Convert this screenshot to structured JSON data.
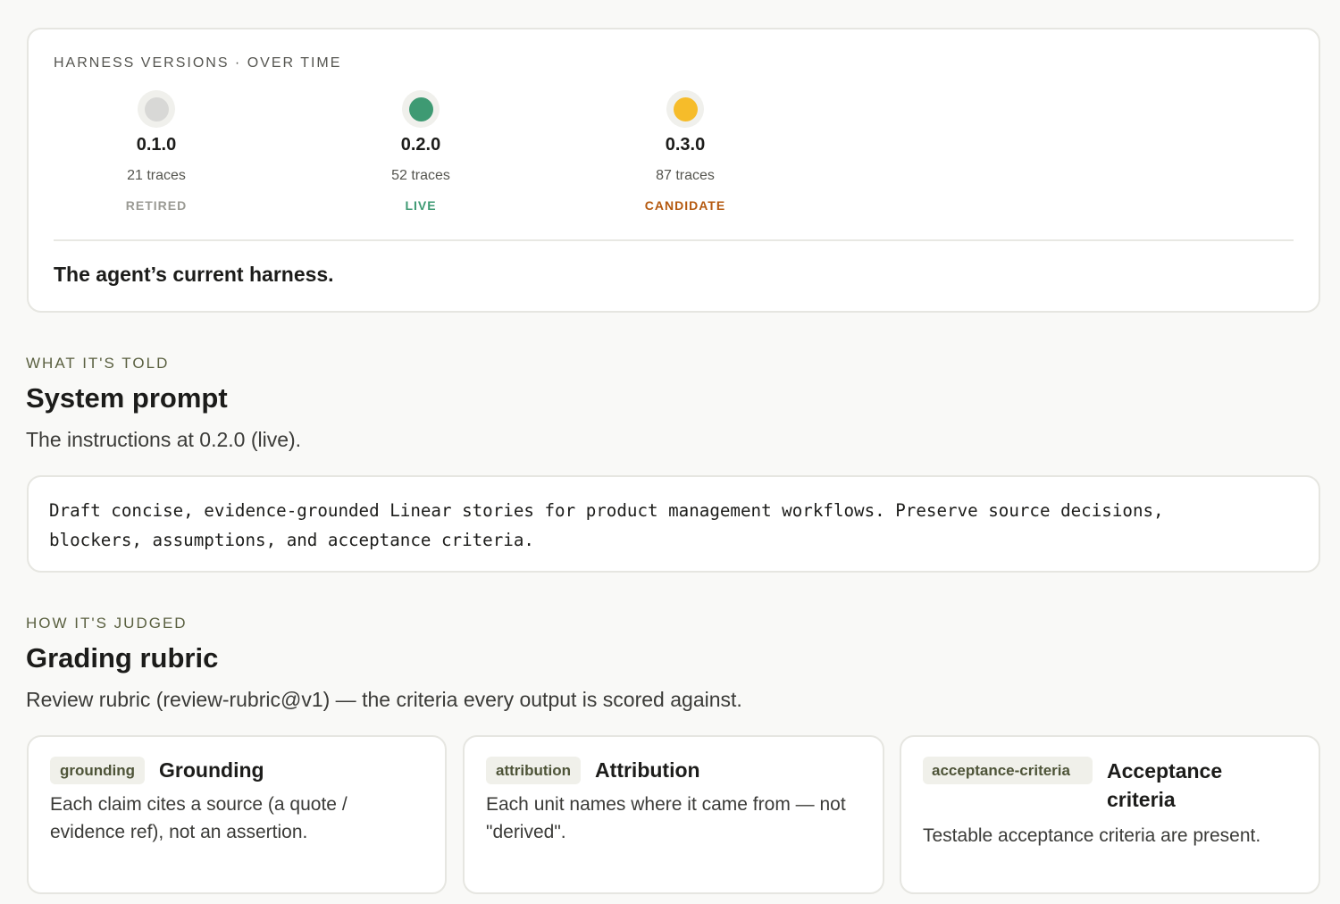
{
  "versions_card": {
    "eyebrow": "HARNESS VERSIONS · OVER TIME",
    "versions": [
      {
        "version": "0.1.0",
        "traces": "21 traces",
        "status": "RETIRED",
        "dot_color": "#d8d8d6",
        "status_color": "#9a9a94"
      },
      {
        "version": "0.2.0",
        "traces": "52 traces",
        "status": "LIVE",
        "dot_color": "#3e9a73",
        "status_color": "#3e9a73"
      },
      {
        "version": "0.3.0",
        "traces": "87 traces",
        "status": "CANDIDATE",
        "dot_color": "#f6bc2a",
        "status_color": "#b5590f"
      }
    ],
    "headline": "The agent’s current harness."
  },
  "system_prompt": {
    "eyebrow": "WHAT IT'S TOLD",
    "title": "System prompt",
    "subtitle": "The instructions at 0.2.0 (live).",
    "text": "Draft concise, evidence-grounded Linear stories for product management workflows. Preserve source decisions,\nblockers, assumptions, and acceptance criteria."
  },
  "rubric": {
    "eyebrow": "HOW IT'S JUDGED",
    "title": "Grading rubric",
    "subtitle": "Review rubric (review-rubric@v1) — the criteria every output is scored against.",
    "criteria": [
      {
        "tag": "grounding",
        "name": "Grounding",
        "description": "Each claim cites a source (a quote / evidence ref), not an assertion."
      },
      {
        "tag": "attribution",
        "name": "Attribution",
        "description": "Each unit names where it came from — not \"derived\"."
      },
      {
        "tag": "acceptance-criteria",
        "name": "Acceptance criteria",
        "description": "Testable acceptance criteria are present."
      }
    ]
  }
}
